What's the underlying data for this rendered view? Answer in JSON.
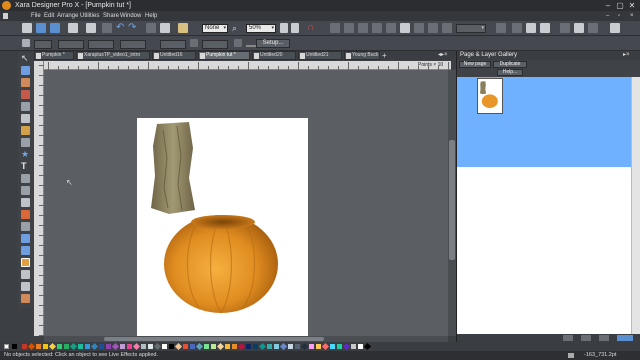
{
  "window": {
    "title": "Xara Designer Pro X - [Pumpkin tut *]"
  },
  "menu": [
    "File",
    "Edit",
    "Arrange",
    "Utilities",
    "Share",
    "Window",
    "Help"
  ],
  "toolbar": {
    "quality_value": "None",
    "zoom_value": "50%",
    "setup_label": "Setup..."
  },
  "tabs": [
    "Pumpkin *",
    "XaraplusTP_video1_intro",
    "Untitled16",
    "Pumpkin tut *",
    "Untitled20",
    "Untitled21",
    "Young Buck"
  ],
  "active_tab_index": 3,
  "ruler": {
    "readout": "Points × 10"
  },
  "gallery": {
    "title": "Page & Layer Gallery",
    "new_page_label": "New page",
    "duplicate_label": "Duplicate",
    "help_label": "Help..."
  },
  "status": {
    "message": "No objects selected: Click an object to see Live Effects applied.",
    "coords": "-163_731.2pt"
  },
  "colors": {
    "accent_selection": "#6fb1ff",
    "pumpkin": "#e8962a",
    "bark": "#8a7f5d"
  },
  "icons": [
    "selector-icon",
    "zoom-icon",
    "pen-icon",
    "text-icon",
    "fill-icon",
    "transparency-icon",
    "shadow-icon",
    "undo-icon",
    "redo-icon",
    "magnet-icon"
  ]
}
